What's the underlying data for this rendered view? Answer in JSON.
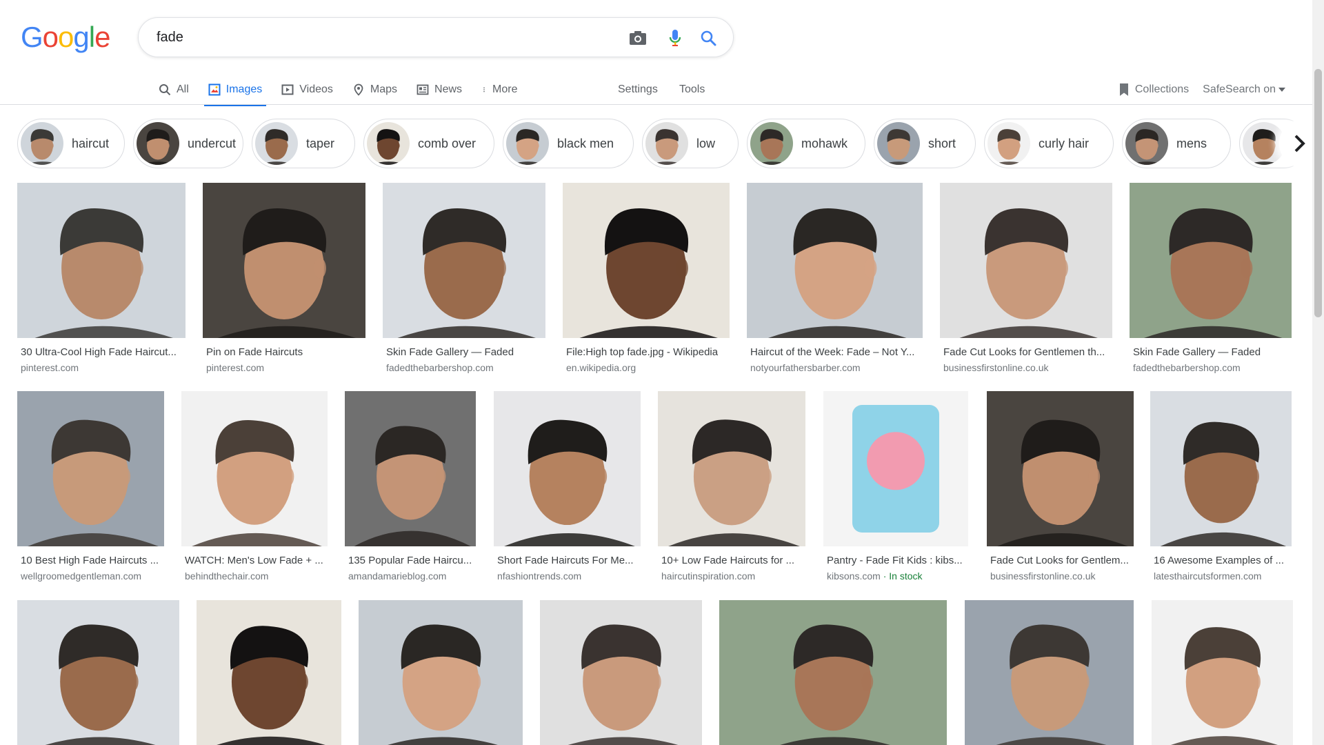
{
  "logo_text": "Google",
  "search": {
    "query": "fade"
  },
  "colors": {
    "accent": "#1a73e8",
    "in_stock": "#188038"
  },
  "tabs": [
    {
      "label": "All",
      "icon": "search-icon",
      "active": false
    },
    {
      "label": "Images",
      "icon": "image-icon",
      "active": true
    },
    {
      "label": "Videos",
      "icon": "video-icon",
      "active": false
    },
    {
      "label": "Maps",
      "icon": "map-pin-icon",
      "active": false
    },
    {
      "label": "News",
      "icon": "news-icon",
      "active": false
    },
    {
      "label": "More",
      "icon": "more-vert-icon",
      "active": false
    }
  ],
  "tools": {
    "settings": "Settings",
    "tools": "Tools"
  },
  "right_links": {
    "collections": "Collections",
    "safesearch": "SafeSearch on"
  },
  "chips": [
    {
      "label": "haircut"
    },
    {
      "label": "undercut"
    },
    {
      "label": "taper"
    },
    {
      "label": "comb over"
    },
    {
      "label": "black men"
    },
    {
      "label": "low"
    },
    {
      "label": "mohawk"
    },
    {
      "label": "short"
    },
    {
      "label": "curly hair"
    },
    {
      "label": "mens"
    },
    {
      "label": ""
    }
  ],
  "rows": [
    [
      {
        "title": "30 Ultra-Cool High Fade Haircut...",
        "source": "pinterest.com"
      },
      {
        "title": "Pin on Fade Haircuts",
        "source": "pinterest.com"
      },
      {
        "title": "Skin Fade Gallery — Faded",
        "source": "fadedthebarbershop.com"
      },
      {
        "title": "File:High top fade.jpg - Wikipedia",
        "source": "en.wikipedia.org"
      },
      {
        "title": "Haircut of the Week: Fade – Not Y...",
        "source": "notyourfathersbarber.com"
      },
      {
        "title": "Fade Cut Looks for Gentlemen th...",
        "source": "businessfirstonline.co.uk"
      },
      {
        "title": "Skin Fade Gallery — Faded",
        "source": "fadedthebarbershop.com"
      }
    ],
    [
      {
        "title": "10 Best High Fade Haircuts ...",
        "source": "wellgroomedgentleman.com"
      },
      {
        "title": "WATCH: Men's Low Fade + ...",
        "source": "behindthechair.com"
      },
      {
        "title": "135 Popular Fade Haircu...",
        "source": "amandamarieblog.com"
      },
      {
        "title": "Short Fade Haircuts For Me...",
        "source": "nfashiontrends.com"
      },
      {
        "title": "10+ Low Fade Haircuts for ...",
        "source": "haircutinspiration.com"
      },
      {
        "title": "Pantry - Fade Fit Kids : kibs...",
        "source": "kibsons.com",
        "stock": " · In stock"
      },
      {
        "title": "Fade Cut Looks for Gentlem...",
        "source": "businessfirstonline.co.uk"
      },
      {
        "title": "16 Awesome Examples of ...",
        "source": "latesthaircutsformen.com"
      }
    ],
    [
      {
        "title": "",
        "source": ""
      },
      {
        "title": "",
        "source": ""
      },
      {
        "title": "",
        "source": ""
      },
      {
        "title": "",
        "source": ""
      },
      {
        "title": "",
        "source": ""
      },
      {
        "title": "",
        "source": ""
      },
      {
        "title": "",
        "source": ""
      }
    ]
  ]
}
